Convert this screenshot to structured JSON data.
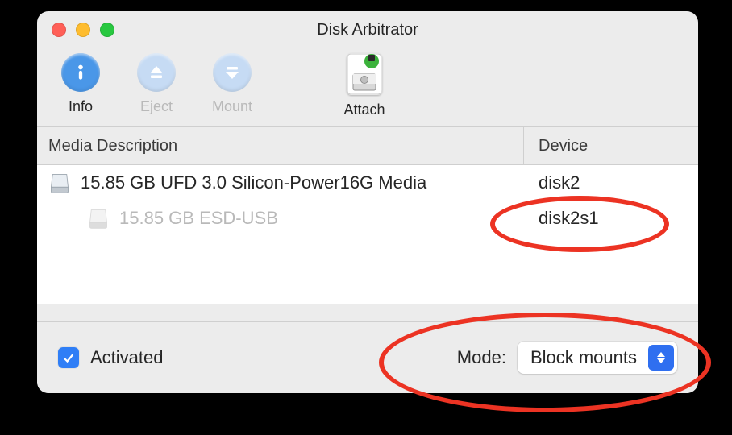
{
  "window": {
    "title": "Disk Arbitrator"
  },
  "toolbar": {
    "info": {
      "label": "Info",
      "icon": "info-icon",
      "enabled": true
    },
    "eject": {
      "label": "Eject",
      "icon": "eject-icon",
      "enabled": false
    },
    "mount": {
      "label": "Mount",
      "icon": "mount-icon",
      "enabled": false
    },
    "attach": {
      "label": "Attach",
      "icon": "attach-icon",
      "enabled": true
    }
  },
  "columns": {
    "media_description": "Media Description",
    "device": "Device"
  },
  "rows": [
    {
      "indent": 0,
      "description": "15.85 GB UFD 3.0 Silicon-Power16G Media",
      "device": "disk2",
      "muted": false
    },
    {
      "indent": 1,
      "description": "15.85 GB ESD-USB",
      "device": "disk2s1",
      "muted": true
    }
  ],
  "footer": {
    "activated_label": "Activated",
    "activated_checked": true,
    "mode_label": "Mode:",
    "mode_value": "Block mounts"
  },
  "annotations": [
    {
      "target": "device-disk2",
      "shape": "ellipse"
    },
    {
      "target": "mode-selector",
      "shape": "ellipse"
    }
  ]
}
